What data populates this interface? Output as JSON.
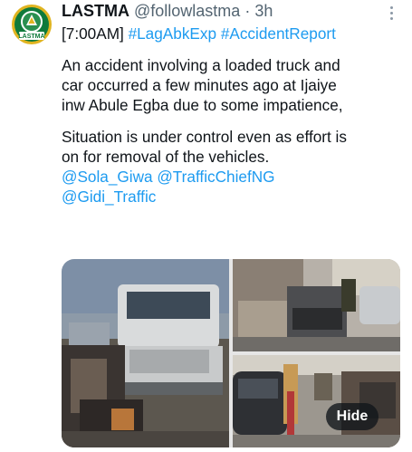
{
  "tweet": {
    "author_name": "LASTMA",
    "handle": "@followlastma",
    "separator": "·",
    "time": "3h",
    "avatar_text": "LASTMA",
    "lines": {
      "l1_prefix": "[7:00AM] ",
      "hashtag1": "#LagAbkExp",
      "hashtag2": "#AccidentReport",
      "l2": "An accident involving a loaded truck and",
      "l3": "car occurred a few minutes ago at Ijaiye",
      "l4": "inw Abule Egba due to some impatience,",
      "l5": "Situation is under control even as effort is",
      "l6": "on for removal of the vehicles.",
      "mention1": "@Sola_Giwa",
      "mention2": "@TrafficChiefNG",
      "mention3": "@Gidi_Traffic"
    },
    "hide_label": "Hide"
  },
  "icons": {
    "more": "more-horizontal-dots-icon"
  },
  "colors": {
    "link": "#1d9bf0",
    "muted": "#536471",
    "logo_green": "#0f7a3b",
    "logo_gold": "#e0b420"
  }
}
